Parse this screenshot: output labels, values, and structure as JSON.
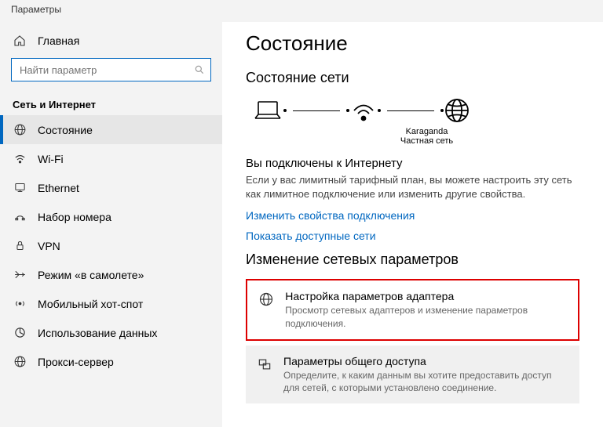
{
  "window_title": "Параметры",
  "home_label": "Главная",
  "search_placeholder": "Найти параметр",
  "section": "Сеть и Интернет",
  "nav": {
    "status": "Состояние",
    "wifi": "Wi-Fi",
    "ethernet": "Ethernet",
    "dialup": "Набор номера",
    "vpn": "VPN",
    "airplane": "Режим «в самолете»",
    "hotspot": "Мобильный хот-спот",
    "datausage": "Использование данных",
    "proxy": "Прокси-сервер"
  },
  "page_heading": "Состояние",
  "net_status_heading": "Состояние сети",
  "net_name": "Karaganda",
  "net_type": "Частная сеть",
  "connected_heading": "Вы подключены к Интернету",
  "connected_text": "Если у вас лимитный тарифный план, вы можете настроить эту сеть как лимитное подключение или изменить другие свойства.",
  "link_props": "Изменить свойства подключения",
  "link_networks": "Показать доступные сети",
  "change_settings_heading": "Изменение сетевых параметров",
  "adapter_title": "Настройка параметров адаптера",
  "adapter_desc": "Просмотр сетевых адаптеров и изменение параметров подключения.",
  "sharing_title": "Параметры общего доступа",
  "sharing_desc": "Определите, к каким данным вы хотите предоставить доступ для сетей, с которыми установлено соединение."
}
